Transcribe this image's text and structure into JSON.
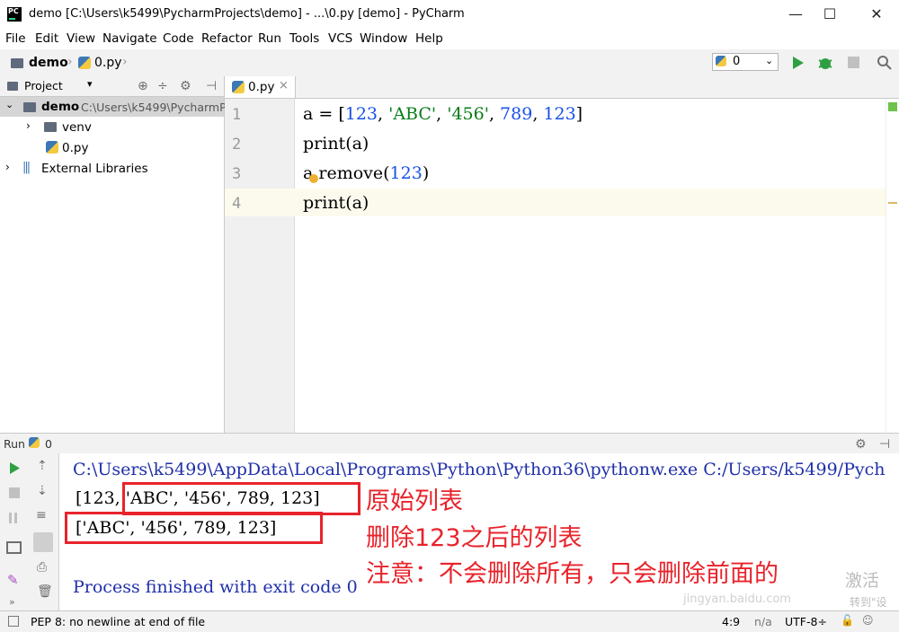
{
  "window": {
    "title": "demo [C:\\Users\\k5499\\PycharmProjects\\demo] - ...\\0.py [demo] - PyCharm",
    "logo_text": "PC",
    "controls": {
      "minimize": "—",
      "maximize": "☐",
      "close": "✕"
    }
  },
  "menu": [
    "File",
    "Edit",
    "View",
    "Navigate",
    "Code",
    "Refactor",
    "Run",
    "Tools",
    "VCS",
    "Window",
    "Help"
  ],
  "navbar": {
    "breadcrumb_project": "demo",
    "breadcrumb_file": "0.py",
    "run_config": "0"
  },
  "project_panel": {
    "title": "Project",
    "root_name": "demo",
    "root_path": "C:\\Users\\k5499\\PycharmP",
    "items": [
      {
        "label": "venv"
      },
      {
        "label": "0.py"
      },
      {
        "label": "External Libraries"
      }
    ]
  },
  "editor": {
    "tab_label": "0.py",
    "tab_close": "×",
    "line_numbers": [
      "1",
      "2",
      "3",
      "4"
    ],
    "code": [
      "a = [123, 'ABC', '456', 789, 123]",
      "print(a)",
      "a.remove(123)",
      "print(a)"
    ],
    "code_parts": {
      "l1_a": "a = [",
      "l1_n1": "123",
      "l1_c1": ", ",
      "l1_s1": "'ABC'",
      "l1_c2": ", ",
      "l1_s2": "'456'",
      "l1_c3": ", ",
      "l1_n2": "789",
      "l1_c4": ", ",
      "l1_n3": "123",
      "l1_end": "]",
      "l3_a": "a.remove(",
      "l3_n": "123",
      "l3_end": ")"
    }
  },
  "run_panel": {
    "label": "Run",
    "config": "0",
    "console": {
      "command": "C:\\Users\\k5499\\AppData\\Local\\Programs\\Python\\Python36\\pythonw.exe C:/Users/k5499/Pych",
      "output_1": "[123, 'ABC', '456', 789, 123]",
      "output_2": "['ABC', '456', 789, 123]",
      "exit_message": "Process finished with exit code 0"
    },
    "annotations": {
      "note_1": "原始列表",
      "note_2": "删除123之后的列表",
      "note_3": "注意：不会删除所有，只会删除前面的"
    }
  },
  "status_bar": {
    "message": "PEP 8: no newline at end of file",
    "position": "4:9",
    "na": "n/a",
    "encoding": "UTF-8÷"
  },
  "watermark": {
    "text_1": "激活",
    "text_2": "转到\"设",
    "text_3": "jingyan.baidu.com"
  },
  "colors": {
    "number": "#1750eb",
    "string": "#067d17",
    "annotation": "#e8232b",
    "console_command": "#1f2fa8"
  }
}
